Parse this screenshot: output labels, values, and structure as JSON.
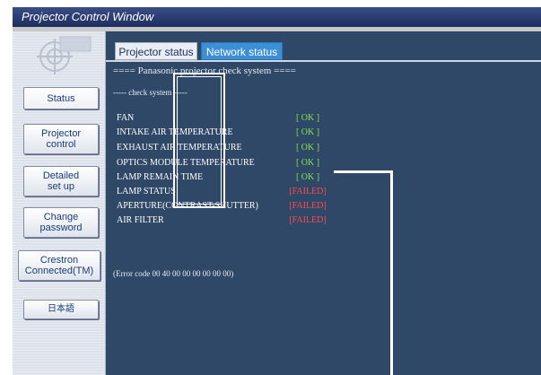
{
  "window": {
    "title": "Projector Control Window"
  },
  "sidebar": {
    "items": [
      {
        "label": "Status"
      },
      {
        "label": "Projector control"
      },
      {
        "label": "Detailed set up"
      },
      {
        "label": "Change password"
      },
      {
        "label": "Crestron Connected(TM)"
      },
      {
        "label": "日本語"
      }
    ]
  },
  "tabs": [
    {
      "label": "Projector status"
    },
    {
      "label": "Network status"
    }
  ],
  "check": {
    "heading": "==== Panasonic projector check system ====",
    "subheading": "----- check system -----",
    "rows": [
      {
        "name": "FAN",
        "status": "[ OK ]",
        "state": "ok"
      },
      {
        "name": "INTAKE AIR TEMPERATURE",
        "status": "[ OK ]",
        "state": "ok"
      },
      {
        "name": "EXHAUST  AIR  TEMPERATURE",
        "status": "[ OK ]",
        "state": "ok"
      },
      {
        "name": "OPTICS MODULE TEMPERATURE",
        "status": "[ OK ]",
        "state": "ok"
      },
      {
        "name": "LAMP REMAIN TIME",
        "status": "[ OK ]",
        "state": "ok"
      },
      {
        "name": "LAMP STATUS",
        "status": "[FAILED]",
        "state": "failed"
      },
      {
        "name": "APERTURE(CONTRAST-SHUTTER)",
        "status": "[FAILED]",
        "state": "failed"
      },
      {
        "name": "AIR FILTER",
        "status": "[FAILED]",
        "state": "failed"
      }
    ],
    "error_code": "(Error code 00 40 00 00 00 00 00 00)"
  },
  "colors": {
    "ok": "#8be04e",
    "failed": "#ff4a4a",
    "panel": "#2f4867",
    "active_tab": "#3b8fd6"
  }
}
